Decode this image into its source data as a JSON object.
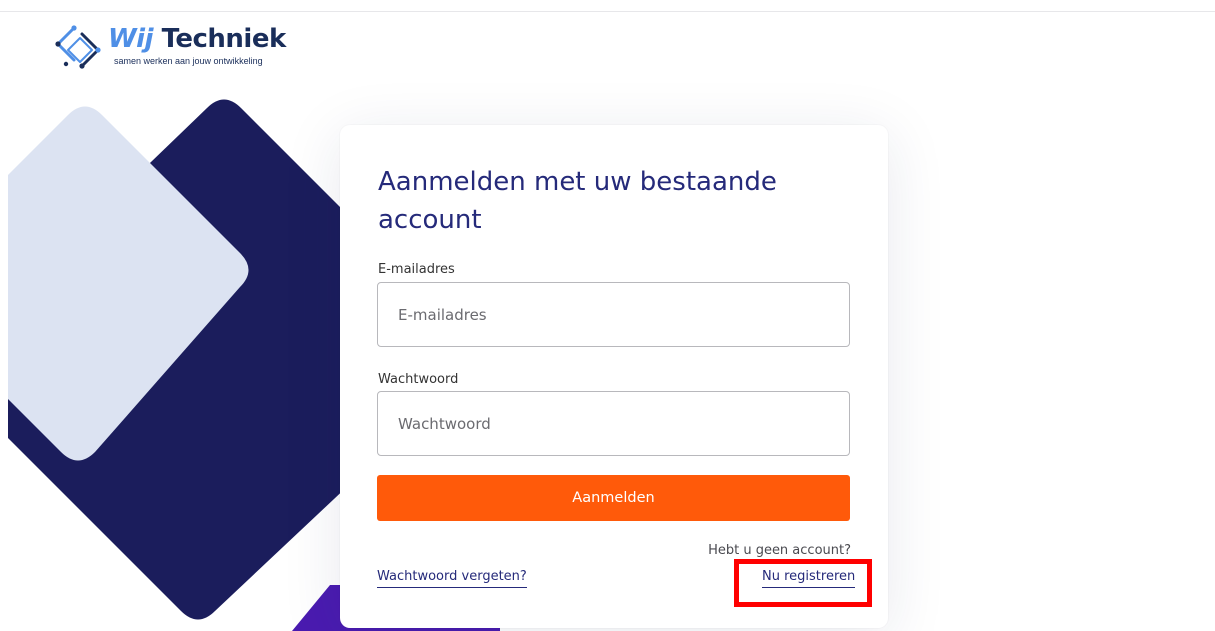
{
  "logo": {
    "brand_part1": "Wij",
    "brand_part2": "Techniek",
    "tagline": "samen werken aan jouw ontwikkeling",
    "icon": "diamond-circuit-logo"
  },
  "colors": {
    "navy": "#1b1d5c",
    "light_blue": "#dce3f2",
    "purple": "#4a1bb0",
    "heading": "#252a7a",
    "button_orange": "#ff5a0a",
    "highlight_red": "#ff0000"
  },
  "login": {
    "title": "Aanmelden met uw bestaande account",
    "email_label": "E-mailadres",
    "email_placeholder": "E-mailadres",
    "password_label": "Wachtwoord",
    "password_placeholder": "Wachtwoord",
    "submit_label": "Aanmelden",
    "forgot_password_link": "Wachtwoord vergeten?",
    "no_account_text": "Hebt u geen account?",
    "register_link": "Nu registreren"
  }
}
